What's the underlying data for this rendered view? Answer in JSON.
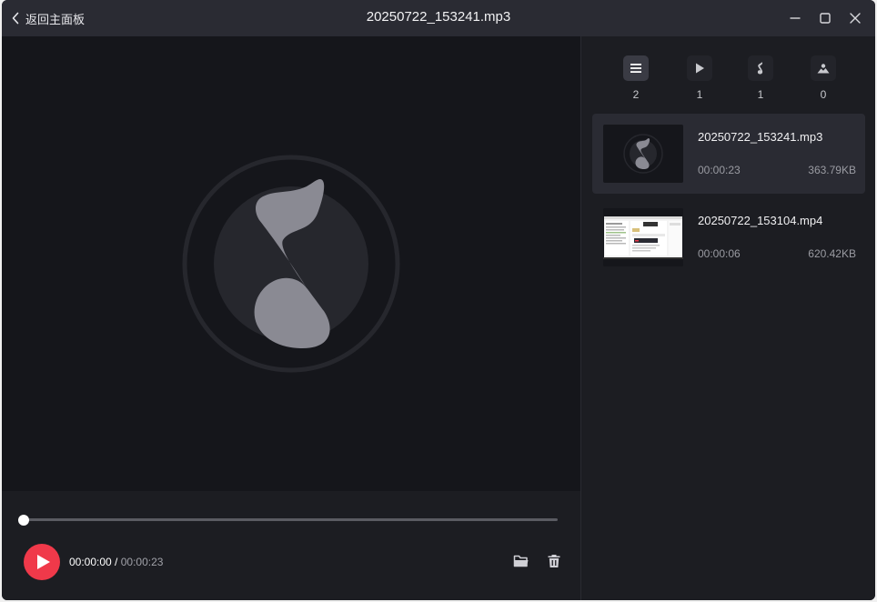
{
  "window": {
    "back_label": "返回主面板",
    "title": "20250722_153241.mp3"
  },
  "player": {
    "current_time": "00:00:00",
    "separator": " / ",
    "duration": "00:00:23",
    "progress": 0
  },
  "filters": [
    {
      "name": "all",
      "icon": "list-icon",
      "count": "2"
    },
    {
      "name": "video",
      "icon": "play-icon",
      "count": "1"
    },
    {
      "name": "audio",
      "icon": "music-note-icon",
      "count": "1"
    },
    {
      "name": "image",
      "icon": "image-icon",
      "count": "0"
    }
  ],
  "files": [
    {
      "name": "20250722_153241.mp3",
      "duration": "00:00:23",
      "size": "363.79KB"
    },
    {
      "name": "20250722_153104.mp4",
      "duration": "00:00:06",
      "size": "620.42KB"
    }
  ],
  "colors": {
    "accent": "#f0394a",
    "window_bg": "#1c1d22",
    "player_bg": "#15161b",
    "titlebar_bg": "#2a2b33"
  }
}
